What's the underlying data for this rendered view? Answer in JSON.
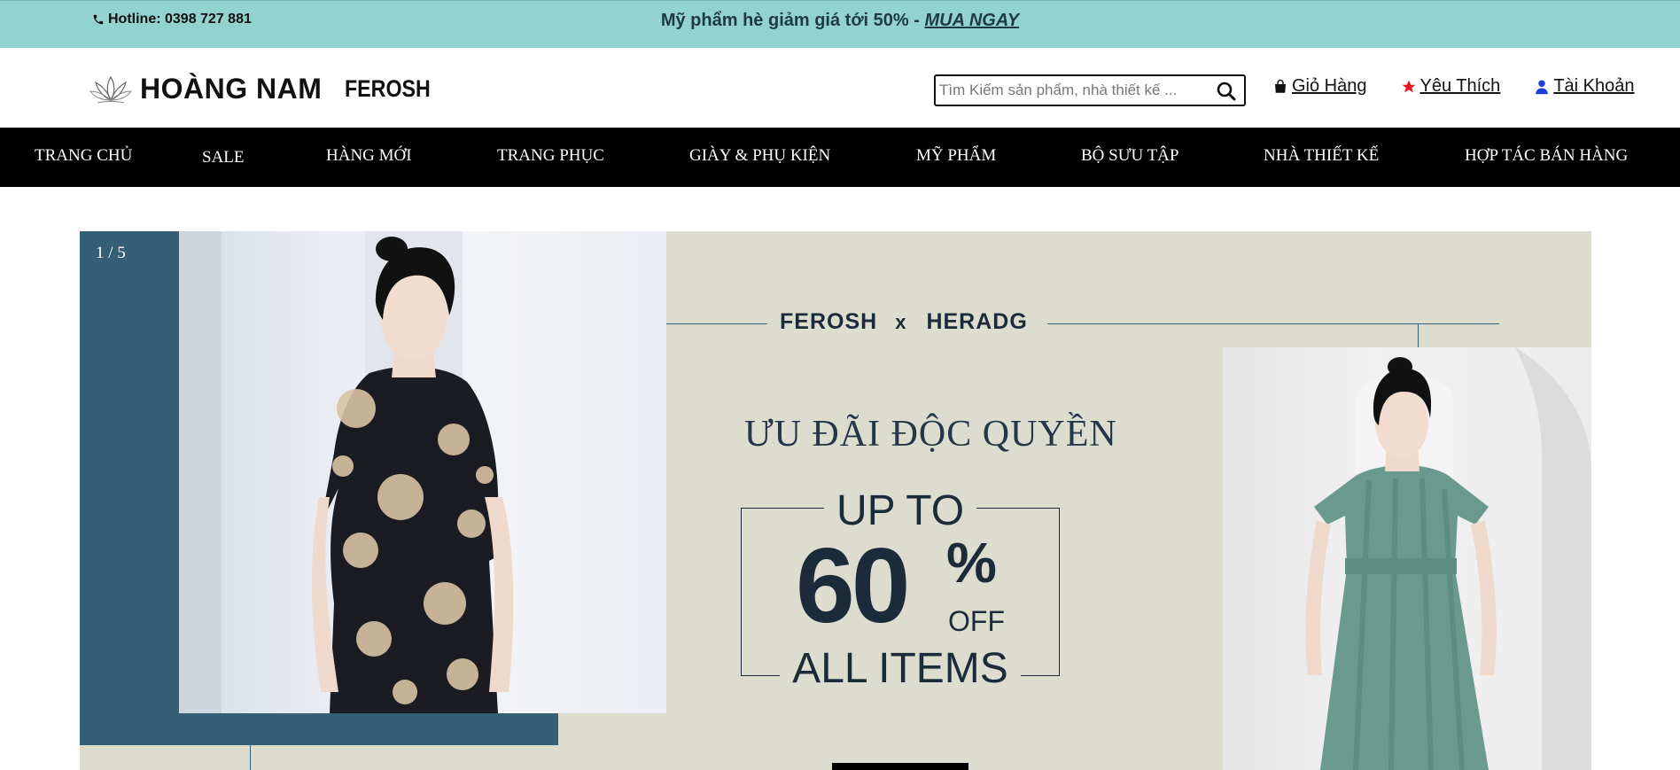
{
  "topbar": {
    "hotline": "Hotline: 0398 727 881",
    "promo_text": "Mỹ phẩm hè giảm giá tới 50% - ",
    "promo_link": "MUA NGAY"
  },
  "header": {
    "logo_name": "HOÀNG NAM",
    "logo_sub": "FEROSH",
    "search_placeholder": "Tìm Kiếm sản phẩm, nhà thiết kế ...",
    "links": {
      "cart": "Giỏ Hàng",
      "wishlist": "Yêu Thích",
      "account": "Tài Khoản"
    }
  },
  "nav": {
    "items": [
      "TRANG CHỦ",
      "SALE",
      "HÀNG MỚI",
      "TRANG PHỤC",
      "GIÀY & PHỤ KIỆN",
      "MỸ PHẨM",
      "BỘ SƯU TẬP",
      "NHÀ THIẾT KẾ",
      "HỢP TÁC BÁN HÀNG"
    ]
  },
  "banner": {
    "counter": "1 / 5",
    "brand_a": "FEROSH",
    "brand_x": "x",
    "brand_b": "HERADG",
    "headline": "ƯU ĐÃI ĐỘC QUYỀN",
    "up_to": "UP TO",
    "percent": "60",
    "percent_sign": "%",
    "off": "OFF",
    "all_items": "ALL ITEMS"
  },
  "colors": {
    "topbar_bg": "#93d3cf",
    "nav_bg": "#000000",
    "banner_bg": "#dcdccf",
    "banner_accent": "#345f74",
    "wishlist_star": "#e8141b",
    "account_icon": "#1a3fd6"
  },
  "icons": [
    "phone-icon",
    "search-icon",
    "shopping-bag-icon",
    "star-icon",
    "user-icon",
    "lotus-logo-icon"
  ]
}
